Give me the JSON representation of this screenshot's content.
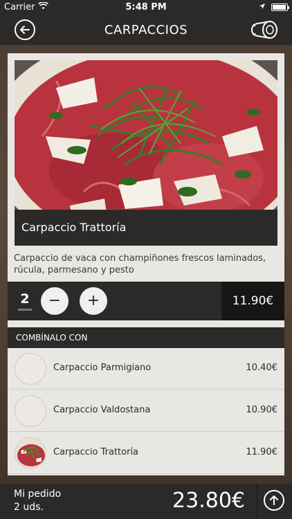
{
  "status_bar": {
    "carrier": "Carrier",
    "time": "5:48 PM",
    "icons": [
      "wifi-icon",
      "location-arrow-icon",
      "battery-icon"
    ]
  },
  "nav": {
    "title": "CARPACCIOS",
    "left_icon": "back-arrow-icon",
    "right_icon": "meat-cut-icon"
  },
  "product": {
    "name": "Carpaccio Trattoría",
    "description": "Carpaccio de vaca con champiñones frescos laminados, rúcula, parmesano y pesto",
    "quantity": "2",
    "minus_label": "−",
    "plus_label": "+",
    "price": "11.90€"
  },
  "combine": {
    "header": "COMBÍNALO CON",
    "items": [
      {
        "name": "Carpaccio Parmigiano",
        "price": "10.40€"
      },
      {
        "name": "Carpaccio Valdostana",
        "price": "10.90€"
      },
      {
        "name": "Carpaccio Trattoría",
        "price": "11.90€"
      }
    ]
  },
  "footer": {
    "order_label": "Mi pedido",
    "order_count": "2 uds.",
    "total": "23.80€",
    "up_icon": "arrow-up-icon"
  },
  "colors": {
    "bar": "#2c2a29",
    "card": "#e9e7e3",
    "price_box": "#171615"
  }
}
